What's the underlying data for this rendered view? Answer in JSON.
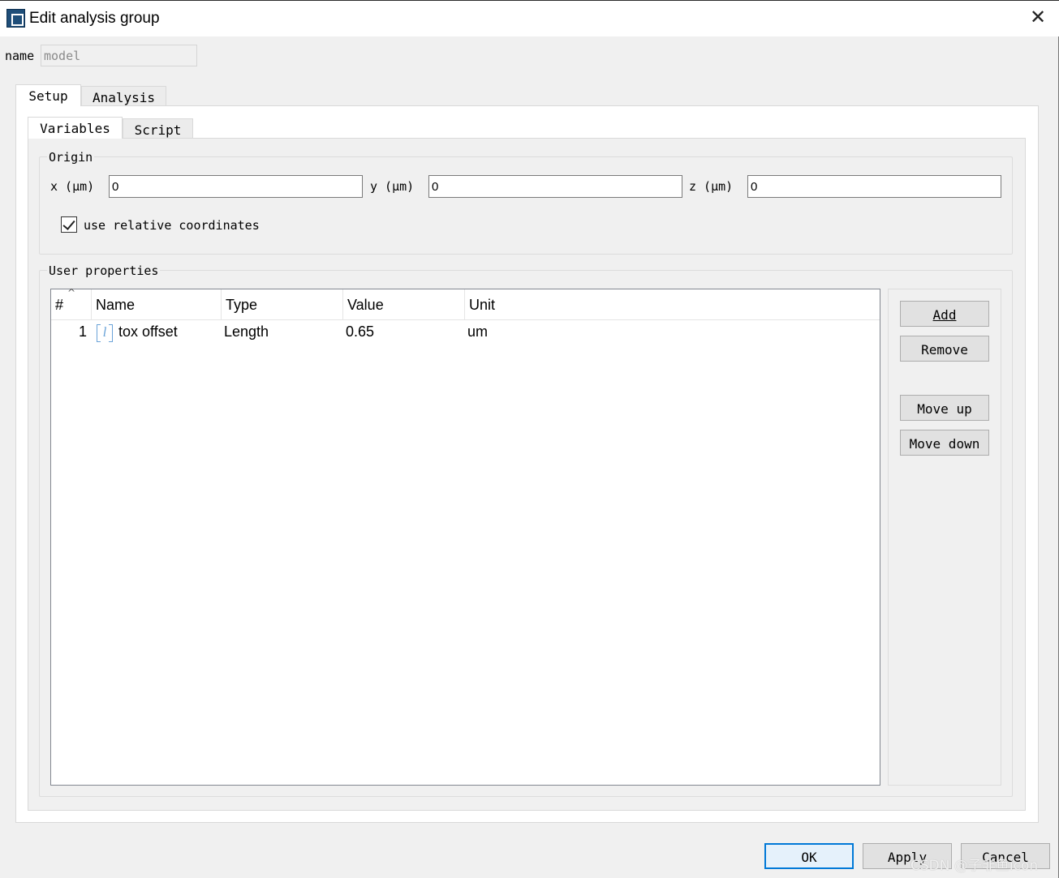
{
  "window": {
    "title": "Edit analysis group",
    "close_glyph": "✕",
    "icon": "app-window-icon"
  },
  "name_field": {
    "label": "name",
    "value": "model"
  },
  "outer_tabs": [
    {
      "label": "Setup",
      "active": true
    },
    {
      "label": "Analysis",
      "active": false
    }
  ],
  "inner_tabs": [
    {
      "label": "Variables",
      "active": true
    },
    {
      "label": "Script",
      "active": false
    }
  ],
  "origin": {
    "title": "Origin",
    "x_label": "x (μm)",
    "y_label": "y (μm)",
    "z_label": "z (μm)",
    "x_value": "0",
    "y_value": "0",
    "z_value": "0",
    "relative_label": "use relative coordinates",
    "relative_checked": true
  },
  "user_properties": {
    "title": "User properties",
    "columns": [
      "#",
      "Name",
      "Type",
      "Value",
      "Unit"
    ],
    "rows": [
      {
        "num": "1",
        "type_icon": "length-type-icon",
        "name": "tox offset",
        "type": "Length",
        "value": "0.65",
        "unit": "um"
      }
    ],
    "buttons": {
      "add": "Add",
      "remove": "Remove",
      "move_up": "Move up",
      "move_down": "Move down"
    }
  },
  "footer": {
    "ok": "OK",
    "apply": "Apply",
    "cancel": "Cancel",
    "watermark": "CSDN @子非鱼icon"
  }
}
